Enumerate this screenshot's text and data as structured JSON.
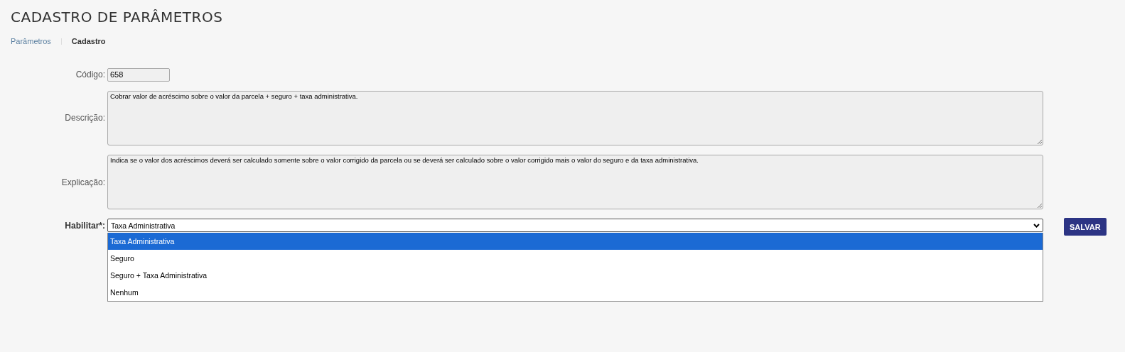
{
  "page_title": "CADASTRO DE PARÂMETROS",
  "breadcrumb": [
    {
      "label": "Parâmetros",
      "selected": false
    },
    {
      "label": "Cadastro",
      "selected": true
    }
  ],
  "form": {
    "code": {
      "label": "Código:",
      "value": "658"
    },
    "description": {
      "label": "Descrição:",
      "value": "Cobrar valor de acréscimo sobre o valor da parcela + seguro + taxa administrativa."
    },
    "explanation": {
      "label": "Explicação:",
      "value": "Indica se o valor dos acréscimos deverá ser calculado somente sobre o valor corrigido da parcela ou se deverá ser calculado sobre o valor corrigido mais o valor do seguro e da taxa administrativa."
    },
    "enable": {
      "label": "Habilitar*:",
      "value": "Taxa Administrativa",
      "expanded": true,
      "options": [
        {
          "label": "Taxa Administrativa",
          "selected": true
        },
        {
          "label": "Seguro",
          "selected": false
        },
        {
          "label": "Seguro + Taxa Administrativa",
          "selected": false
        },
        {
          "label": "Nenhum",
          "selected": false
        }
      ]
    }
  },
  "save_button": "SALVAR"
}
